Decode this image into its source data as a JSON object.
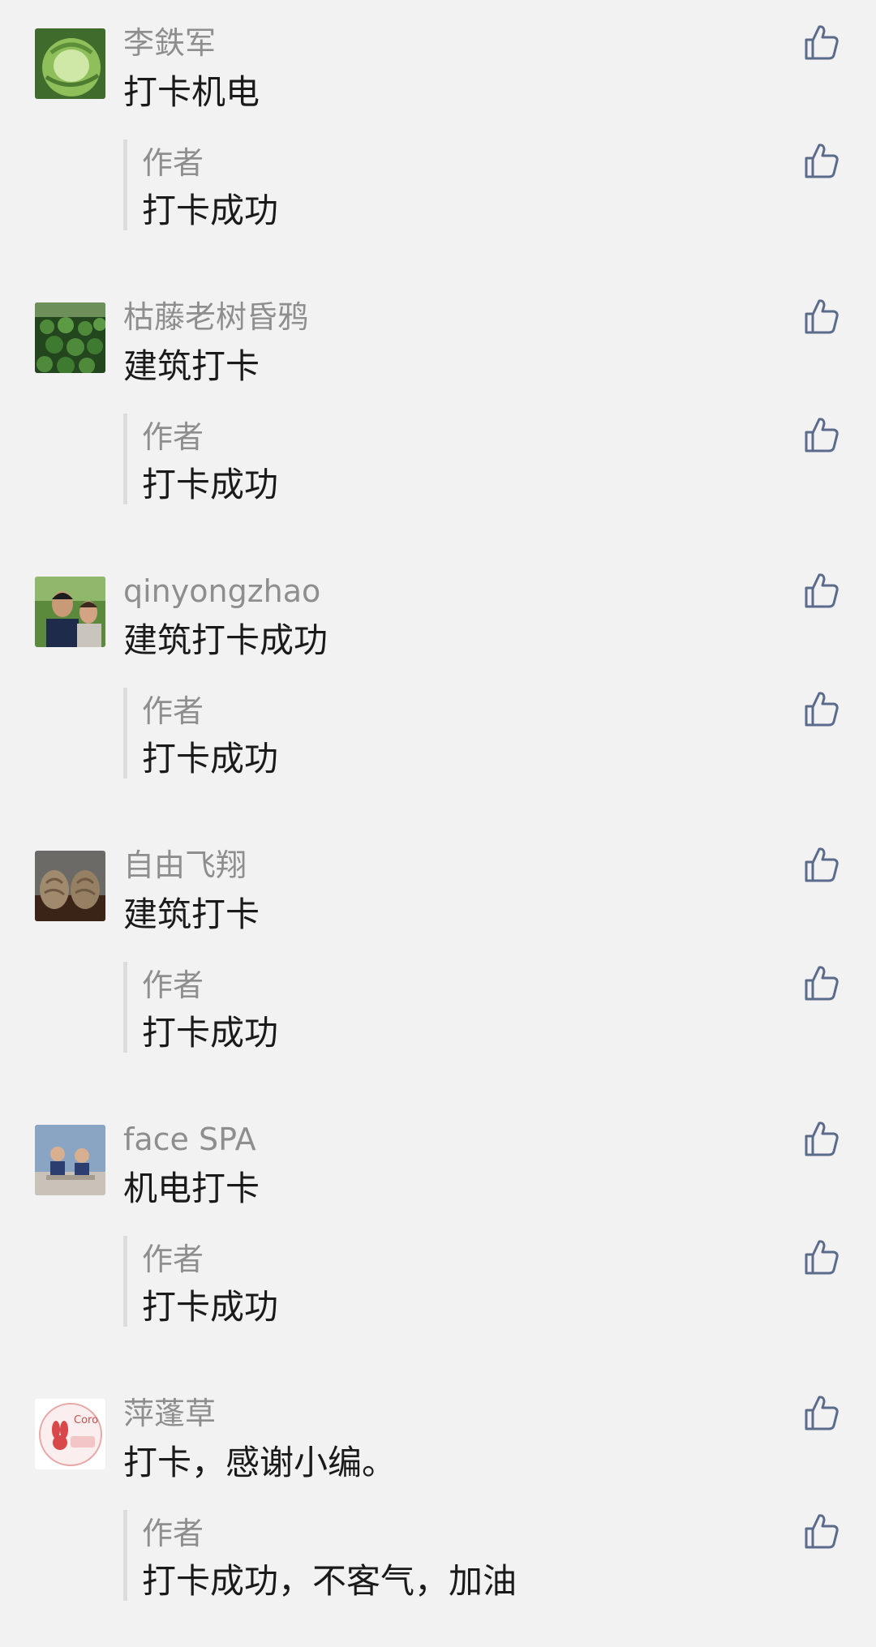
{
  "comments": [
    {
      "name": "李鉄军",
      "text": "打卡机电",
      "reply": {
        "author": "作者",
        "text": "打卡成功"
      }
    },
    {
      "name": "枯藤老树昏鸦",
      "text": "建筑打卡",
      "reply": {
        "author": "作者",
        "text": "打卡成功"
      }
    },
    {
      "name": "qinyongzhao",
      "text": "建筑打卡成功",
      "reply": {
        "author": "作者",
        "text": "打卡成功"
      }
    },
    {
      "name": "自由飞翔",
      "text": "建筑打卡",
      "reply": {
        "author": "作者",
        "text": "打卡成功"
      }
    },
    {
      "name": "face SPA",
      "text": "机电打卡",
      "reply": {
        "author": "作者",
        "text": "打卡成功"
      }
    },
    {
      "name": "萍蓬草",
      "text": "打卡，感谢小编。",
      "reply": {
        "author": "作者",
        "text": "打卡成功，不客气，加油"
      }
    }
  ],
  "avatar_logo_text": "Coro",
  "icons": {
    "like": "thumbs-up-icon"
  },
  "colors": {
    "background": "#f2f2f2",
    "name": "#8e8e8e",
    "text": "#1a1a1a",
    "icon": "#5a6b8c",
    "reply_bar": "#dcdcdc"
  }
}
